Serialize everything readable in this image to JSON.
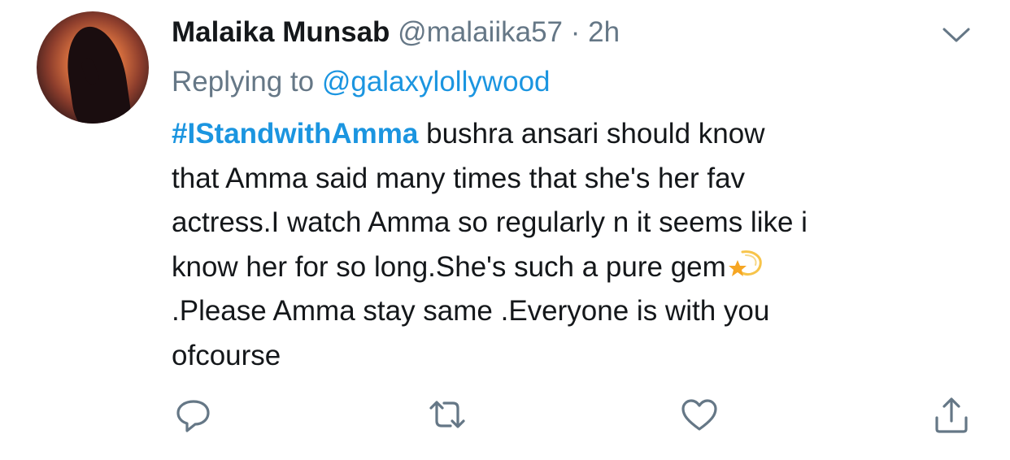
{
  "tweet": {
    "author_name": "Malaika Munsab",
    "handle": "@malaiika57",
    "separator": "·",
    "time": "2h",
    "reply_prefix": "Replying to",
    "reply_mention": "@galaxylollywood",
    "hashtag": "#IStandwithAmma",
    "lines": [
      " bushra ansari should know",
      "that Amma said many times that she's her fav",
      "actress.I watch Amma so regularly n it seems like i",
      "know her for so long.She's such a pure gem",
      ".Please Amma stay same .Everyone is with you",
      "ofcourse"
    ],
    "emoji": "dizzy-star-emoji"
  },
  "icons": {
    "menu": "chevron-down-icon",
    "reply": "reply-icon",
    "retweet": "retweet-icon",
    "like": "heart-icon",
    "share": "share-icon"
  },
  "colors": {
    "text": "#14171a",
    "secondary": "#657786",
    "link": "#1b95e0",
    "icon": "#657786"
  }
}
